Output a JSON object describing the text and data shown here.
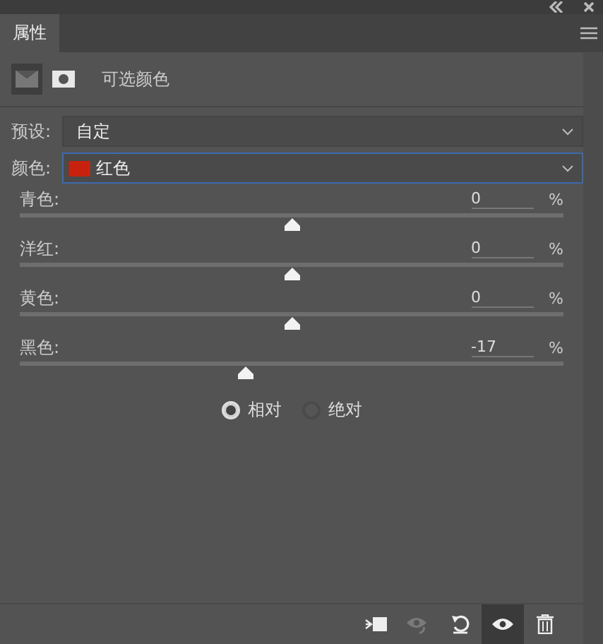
{
  "tabs": [
    {
      "label": "属性",
      "selected": true
    }
  ],
  "panel": {
    "title": "可选颜色",
    "modes": [
      {
        "kind": "adjustment",
        "selected": true
      },
      {
        "kind": "mask",
        "selected": false
      }
    ]
  },
  "fields": [
    {
      "label": "预设:",
      "value": "自定",
      "focused": false
    },
    {
      "label": "颜色:",
      "value": "红色",
      "focused": true,
      "color": "#c8220e"
    }
  ],
  "sliders": [
    {
      "name": "青色:",
      "value": "0",
      "unit": "%",
      "level": 0.5
    },
    {
      "name": "洋红:",
      "value": "0",
      "unit": "%",
      "level": 0.5
    },
    {
      "name": "黄色:",
      "value": "0",
      "unit": "%",
      "level": 0.5
    },
    {
      "name": "黑色:",
      "value": "-17",
      "unit": "%",
      "level": 0.415
    }
  ],
  "method": [
    {
      "label": "相对",
      "selected": true
    },
    {
      "label": "绝对",
      "selected": false
    }
  ],
  "toolbar": [
    {
      "kind": "clip",
      "active": false
    },
    {
      "kind": "view-previous",
      "active": false,
      "disabled": true
    },
    {
      "kind": "reset",
      "active": false
    },
    {
      "kind": "visibility",
      "active": true
    },
    {
      "kind": "delete",
      "active": false
    }
  ]
}
